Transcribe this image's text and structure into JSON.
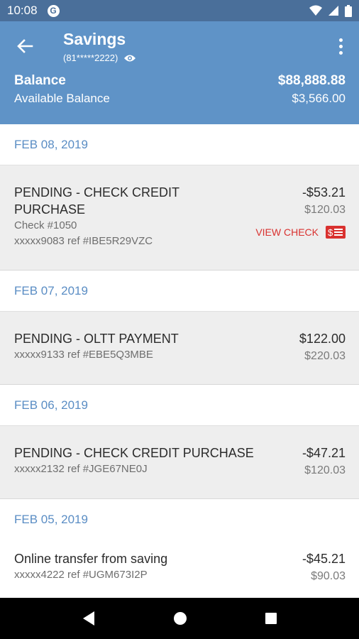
{
  "status_bar": {
    "time": "10:08",
    "app_icon": "G"
  },
  "app_bar": {
    "title": "Savings",
    "account_masked": "(81*****2222)",
    "balance_label": "Balance",
    "balance_value": "$88,888.88",
    "available_label": "Available Balance",
    "available_value": "$3,566.00"
  },
  "groups": [
    {
      "date": "FEB 08, 2019",
      "transactions": [
        {
          "description_line1": "PENDING - CHECK CREDIT",
          "description_line2": "PURCHASE",
          "check_number": "Check #1050",
          "reference": "xxxxx9083 ref #IBE5R29VZC",
          "amount": "-$53.21",
          "balance": "$120.03",
          "view_check_label": "VIEW CHECK"
        }
      ]
    },
    {
      "date": "FEB 07, 2019",
      "transactions": [
        {
          "description": "PENDING - OLTT PAYMENT",
          "reference": "xxxxx9133 ref #EBE5Q3MBE",
          "amount": "$122.00",
          "balance": "$220.03"
        }
      ]
    },
    {
      "date": "FEB 06, 2019",
      "transactions": [
        {
          "description": "PENDING - CHECK CREDIT PURCHASE",
          "reference": "xxxxx2132 ref #JGE67NE0J",
          "amount": "-$47.21",
          "balance": "$120.03"
        }
      ]
    },
    {
      "date": "FEB 05, 2019",
      "transactions": [
        {
          "description": "Online transfer from saving",
          "reference": "xxxxx4222 ref #UGM673I2P",
          "amount": "-$45.21",
          "balance": "$90.03"
        }
      ]
    }
  ],
  "colors": {
    "status_bar": "#4a6f9a",
    "app_bar": "#5f93c7",
    "date_header_text": "#5a8dc4",
    "view_check": "#d9312f"
  },
  "icons": {
    "back": "arrow-left-icon",
    "visibility": "eye-icon",
    "menu": "more-vert-icon",
    "check": "check-image-icon"
  }
}
